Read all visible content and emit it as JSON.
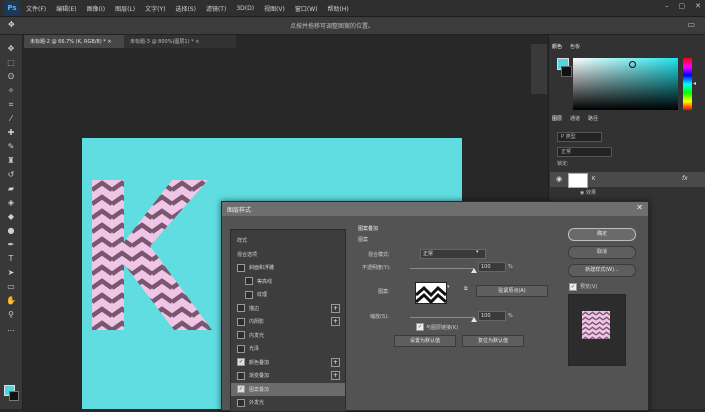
{
  "app": {
    "logo": "Ps"
  },
  "menu": [
    "文件(F)",
    "编辑(E)",
    "图像(I)",
    "图层(L)",
    "文字(Y)",
    "选择(S)",
    "滤镜(T)",
    "3D(D)",
    "视图(V)",
    "窗口(W)",
    "帮助(H)"
  ],
  "window_controls": [
    "–",
    "▢",
    "✕"
  ],
  "options_bar": {
    "hint": "点按并拖移可调整图案的位置。"
  },
  "tabs": [
    {
      "label": "未标题-2 @ 66.7% (K, RGB/8) * ×"
    },
    {
      "label": "未标题-3 @ 800%(图层1) * ×"
    }
  ],
  "panels": {
    "color_tabs": [
      "颜色",
      "色板"
    ],
    "layers_tabs": [
      "图层",
      "通道",
      "路径"
    ],
    "layers_search": "P 类型",
    "layers_mode": "正常",
    "layers_lock": "锁定:",
    "layer_name": "K",
    "layer_fx": "fx",
    "layer_effects": "◉ 效果"
  },
  "dialog": {
    "title": "图层样式",
    "close": "✕",
    "styles": [
      {
        "label": "样式",
        "checkbox": false,
        "header": true
      },
      {
        "label": "混合选项",
        "checkbox": false
      },
      {
        "label": "斜面和浮雕",
        "checkbox": true,
        "checked": false
      },
      {
        "label": "等高线",
        "checkbox": true,
        "checked": false,
        "indent": true
      },
      {
        "label": "纹理",
        "checkbox": true,
        "checked": false,
        "indent": true
      },
      {
        "label": "描边",
        "checkbox": true,
        "checked": false,
        "plus": true
      },
      {
        "label": "内阴影",
        "checkbox": true,
        "checked": false,
        "plus": true
      },
      {
        "label": "内发光",
        "checkbox": true,
        "checked": false
      },
      {
        "label": "光泽",
        "checkbox": true,
        "checked": false
      },
      {
        "label": "颜色叠加",
        "checkbox": true,
        "checked": true,
        "plus": true
      },
      {
        "label": "渐变叠加",
        "checkbox": true,
        "checked": false,
        "plus": true
      },
      {
        "label": "图案叠加",
        "checkbox": true,
        "checked": true,
        "selected": true
      },
      {
        "label": "外发光",
        "checkbox": true,
        "checked": false
      }
    ],
    "settings": {
      "section_title": "图案叠加",
      "subsection": "图案",
      "blend_mode_label": "混合模式:",
      "blend_mode_value": "正常",
      "opacity_label": "不透明度(Y):",
      "opacity_value": "100",
      "opacity_unit": "%",
      "pattern_label": "图案:",
      "snap_origin_button": "贴紧原点(A)",
      "scale_label": "缩放(S):",
      "scale_value": "100",
      "scale_unit": "%",
      "link_label": "与图层链接(K)",
      "set_default_button": "设置为默认值",
      "reset_default_button": "复位为默认值"
    },
    "buttons": {
      "ok": "确定",
      "cancel": "取消",
      "new_style": "新建样式(W)...",
      "preview_label": "预览(V)"
    }
  },
  "colors": {
    "canvas": "#60dde1",
    "foreground": "#52d6dd",
    "pattern_pink": "#efc6e6",
    "pattern_dark": "#7b5670"
  }
}
